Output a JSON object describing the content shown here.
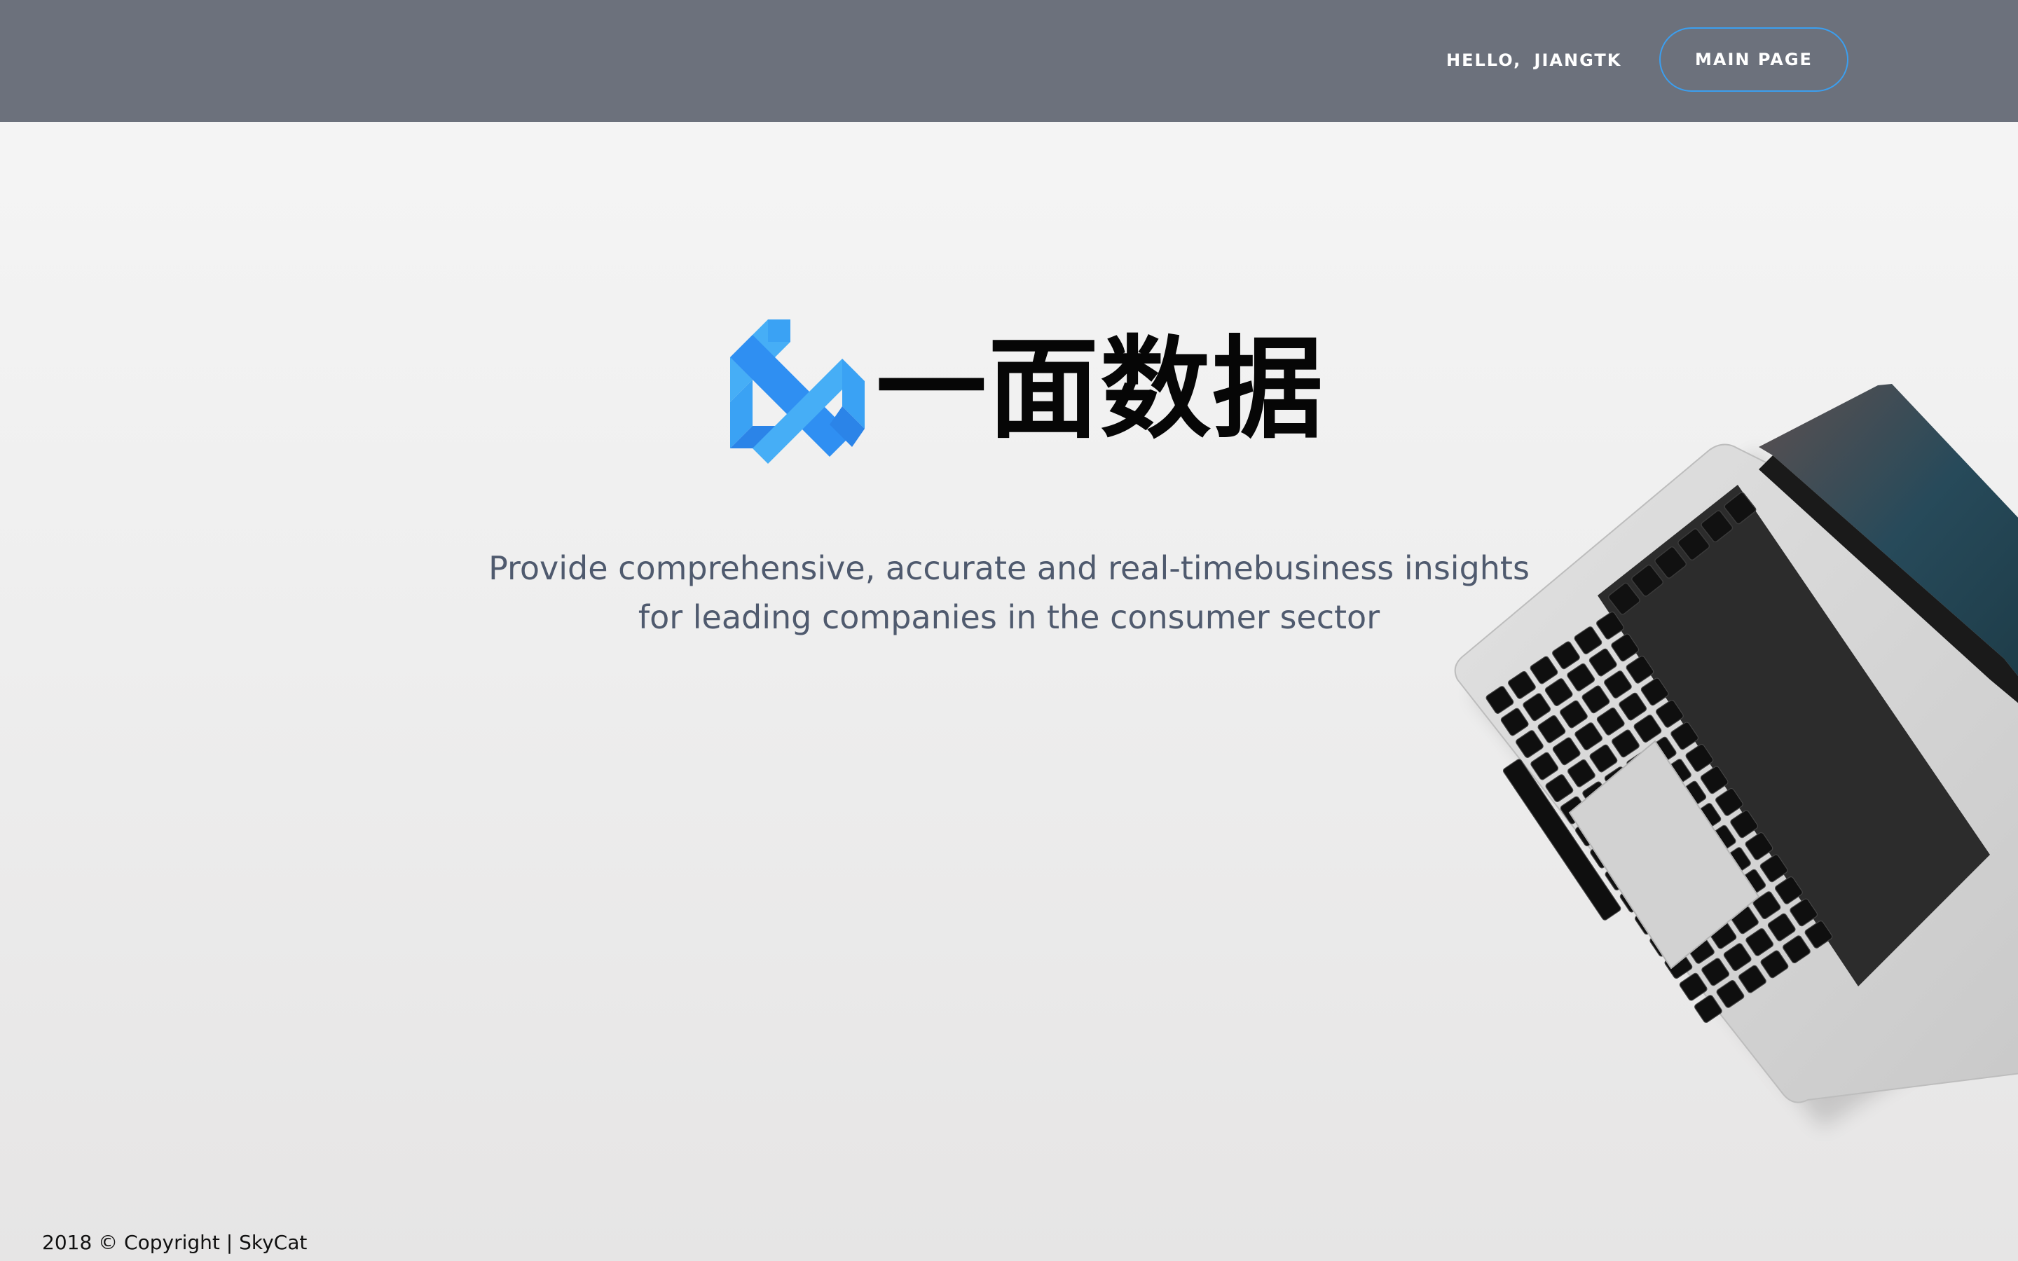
{
  "header": {
    "greeting": "HELLO,  JIANGTK",
    "main_page_label": "MAIN PAGE"
  },
  "hero": {
    "brand_name": "一面数据",
    "tagline_line1": "Provide comprehensive, accurate and real-timebusiness insights",
    "tagline_line2": "for leading companies in the consumer sector"
  },
  "footer": {
    "copyright": "2018 © Copyright | SkyCat"
  },
  "icons": {
    "logo": "ampersand-ribbon-logo",
    "illustration": "laptop-illustration"
  },
  "colors": {
    "header_bg": "#6c717c",
    "button_border": "#3b9ff0",
    "logo_blue": "#2b8cf0",
    "logo_light_blue": "#46aef6",
    "tagline": "#4f5a6e"
  }
}
